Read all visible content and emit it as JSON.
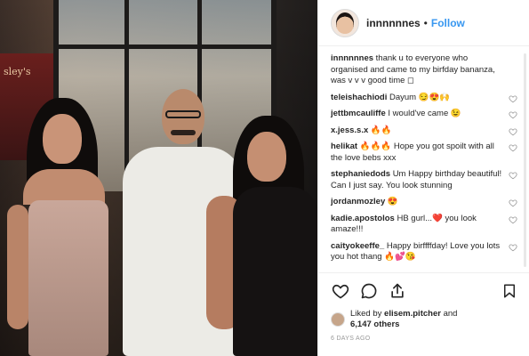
{
  "post": {
    "username": "innnnnnes",
    "header_separator": "•",
    "follow_label": "Follow",
    "caption": "thank u to everyone who organised and came to my birfday bananza, was v v v good time ◻"
  },
  "photo": {
    "sign_text": "sley's"
  },
  "comments": [
    {
      "user": "teleishachiodi",
      "text": "Dayum 😏😍🙌"
    },
    {
      "user": "jettbmcauliffe",
      "text": "I would've came 😉"
    },
    {
      "user": "x.jess.s.x",
      "text": "🔥🔥"
    },
    {
      "user": "helikat",
      "text": "🔥🔥🔥 Hope you got spoilt with all the love bebs xxx"
    },
    {
      "user": "stephaniedods",
      "text": "Um Happy birthday beautiful! Can I just say. You look stunning"
    },
    {
      "user": "jordanmozley",
      "text": "😍"
    },
    {
      "user": "kadie.apostolos",
      "text": "HB gurl...❤️ you look amaze!!!"
    },
    {
      "user": "caityokeeffe_",
      "text": "Happy birffffday! Love you lots you hot thang 🔥💕😘"
    }
  ],
  "likes": {
    "prefix": "Liked by",
    "user": "elisem.pitcher",
    "and": "and",
    "count": "6,147 others"
  },
  "timestamp": "6 DAYS AGO",
  "icons": {
    "like": "heart-outline-icon",
    "comment": "speech-bubble-icon",
    "share": "share-icon",
    "save": "bookmark-icon",
    "comment_like": "small-heart-icon"
  },
  "colors": {
    "follow": "#3897f0",
    "text": "#262626",
    "muted": "#999999",
    "border": "#efefef"
  }
}
